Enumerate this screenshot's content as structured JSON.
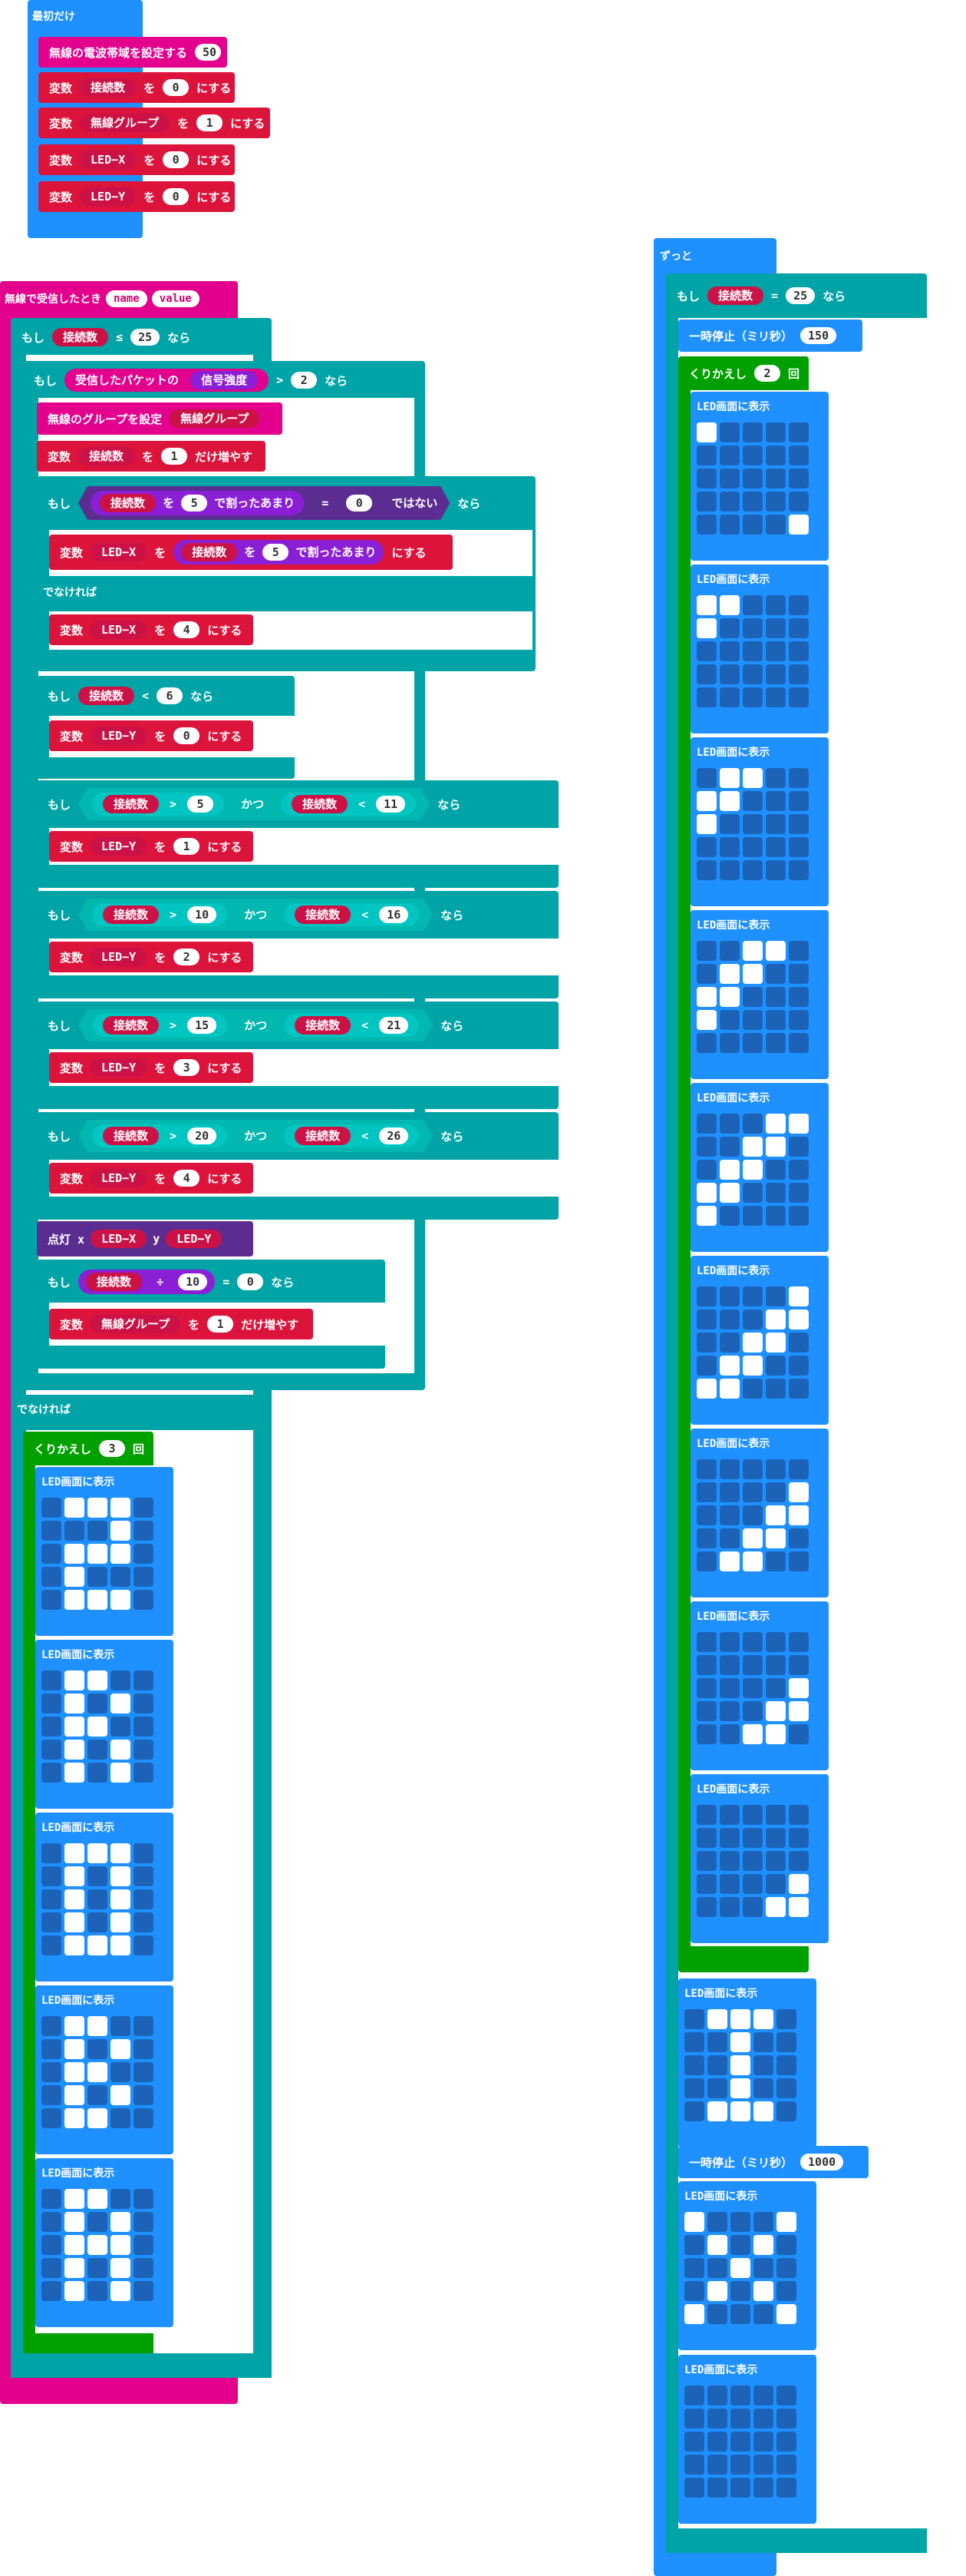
{
  "on_start": {
    "title": "最初だけ",
    "set_radio_band": {
      "label": "無線の電波帯域を設定する",
      "value": "50"
    },
    "set_conn": {
      "var_kw": "変数",
      "name": "接続数",
      "to": "を",
      "value": "0",
      "suffix": "にする"
    },
    "set_group": {
      "var_kw": "変数",
      "name": "無線グループ",
      "to": "を",
      "value": "1",
      "suffix": "にする"
    },
    "set_x": {
      "var_kw": "変数",
      "name": "LED−X",
      "to": "を",
      "value": "0",
      "suffix": "にする"
    },
    "set_y": {
      "var_kw": "変数",
      "name": "LED−Y",
      "to": "を",
      "value": "0",
      "suffix": "にする"
    }
  },
  "on_received": {
    "title": "無線で受信したとき",
    "arg_name": "name",
    "arg_value": "value",
    "if1": {
      "kw": "もし",
      "var": "接続数",
      "op": "≤",
      "value": "25",
      "then": "なら"
    },
    "if2": {
      "kw": "もし",
      "packet": "受信したパケットの",
      "prop": "信号強度",
      "op": ">",
      "value": "2",
      "then": "なら"
    },
    "set_group_block": {
      "label": "無線のグループを設定",
      "var": "無線グループ"
    },
    "change_conn": {
      "var_kw": "変数",
      "name": "接続数",
      "by": "を",
      "value": "1",
      "suffix": "だけ増やす"
    },
    "if_mod": {
      "kw": "もし",
      "var": "接続数",
      "by": "を",
      "div": "5",
      "mod": "で割ったあまり",
      "op": "=",
      "value": "0",
      "not": "ではない",
      "then": "なら"
    },
    "set_x_mod": {
      "var_kw": "変数",
      "name": "LED−X",
      "to": "を",
      "var": "接続数",
      "by": "を",
      "div": "5",
      "mod": "で割ったあまり",
      "suffix": "にする"
    },
    "else_label": "でなければ",
    "set_x4": {
      "var_kw": "変数",
      "name": "LED−X",
      "to": "を",
      "value": "4",
      "suffix": "にする"
    },
    "if_lt6": {
      "kw": "もし",
      "var": "接続数",
      "op": "<",
      "value": "6",
      "then": "なら"
    },
    "set_y0": {
      "var_kw": "変数",
      "name": "LED−Y",
      "to": "を",
      "value": "0",
      "suffix": "にする"
    },
    "ranges": [
      {
        "kw": "もし",
        "var": "接続数",
        "op1": ">",
        "a": "5",
        "and": "かつ",
        "op2": "<",
        "b": "11",
        "then": "なら",
        "var_kw": "変数",
        "name": "LED−Y",
        "to": "を",
        "value": "1",
        "suffix": "にする"
      },
      {
        "kw": "もし",
        "var": "接続数",
        "op1": ">",
        "a": "10",
        "and": "かつ",
        "op2": "<",
        "b": "16",
        "then": "なら",
        "var_kw": "変数",
        "name": "LED−Y",
        "to": "を",
        "value": "2",
        "suffix": "にする"
      },
      {
        "kw": "もし",
        "var": "接続数",
        "op1": ">",
        "a": "15",
        "and": "かつ",
        "op2": "<",
        "b": "21",
        "then": "なら",
        "var_kw": "変数",
        "name": "LED−Y",
        "to": "を",
        "value": "3",
        "suffix": "にする"
      },
      {
        "kw": "もし",
        "var": "接続数",
        "op1": ">",
        "a": "20",
        "and": "かつ",
        "op2": "<",
        "b": "26",
        "then": "なら",
        "var_kw": "変数",
        "name": "LED−Y",
        "to": "を",
        "value": "4",
        "suffix": "にする"
      }
    ],
    "plot": {
      "label": "点灯 x",
      "x": "LED−X",
      "y_kw": "y",
      "y": "LED−Y"
    },
    "if_mod10": {
      "kw": "もし",
      "var": "接続数",
      "op": "÷",
      "div": "10",
      "eq": "=",
      "value": "0",
      "then": "なら"
    },
    "change_group": {
      "var_kw": "変数",
      "name": "無線グループ",
      "by": "を",
      "value": "1",
      "suffix": "だけ増やす"
    },
    "else2_label": "でなければ",
    "repeat": {
      "kw": "くりかえし",
      "count": "3",
      "suffix": "回"
    },
    "show_label": "LED画面に表示",
    "leds": [
      [
        "01110",
        "00010",
        "01110",
        "01000",
        "01110"
      ],
      [
        "01100",
        "01010",
        "01100",
        "01010",
        "01010"
      ],
      [
        "01110",
        "01010",
        "01010",
        "01010",
        "01110"
      ],
      [
        "01100",
        "01010",
        "01100",
        "01010",
        "01100"
      ],
      [
        "01100",
        "01010",
        "01110",
        "01010",
        "01010"
      ]
    ]
  },
  "forever": {
    "title": "ずっと",
    "if": {
      "kw": "もし",
      "var": "接続数",
      "op": "=",
      "value": "25",
      "then": "なら"
    },
    "pause1": {
      "label": "一時停止（ミリ秒）",
      "value": "150"
    },
    "repeat": {
      "kw": "くりかえし",
      "count": "2",
      "suffix": "回"
    },
    "show_label": "LED画面に表示",
    "leds": [
      [
        "10000",
        "00000",
        "00000",
        "00000",
        "00001"
      ],
      [
        "11000",
        "10000",
        "00000",
        "00000",
        "00000"
      ],
      [
        "01100",
        "11000",
        "10000",
        "00000",
        "00000"
      ],
      [
        "00110",
        "01100",
        "11000",
        "10000",
        "00000"
      ],
      [
        "00011",
        "00110",
        "01100",
        "11000",
        "10000"
      ],
      [
        "00001",
        "00011",
        "00110",
        "01100",
        "11000"
      ],
      [
        "00000",
        "00001",
        "00011",
        "00110",
        "01100"
      ],
      [
        "00000",
        "00000",
        "00001",
        "00011",
        "00110"
      ],
      [
        "00000",
        "00000",
        "00000",
        "00001",
        "00011"
      ]
    ],
    "after_repeat_led": [
      "01110",
      "00100",
      "00100",
      "00100",
      "01110"
    ],
    "pause2": {
      "label": "一時停止（ミリ秒）",
      "value": "1000"
    },
    "led_x": [
      "10001",
      "01010",
      "00100",
      "01010",
      "10001"
    ],
    "led_blank": [
      "00000",
      "00000",
      "00000",
      "00000",
      "00000"
    ]
  }
}
